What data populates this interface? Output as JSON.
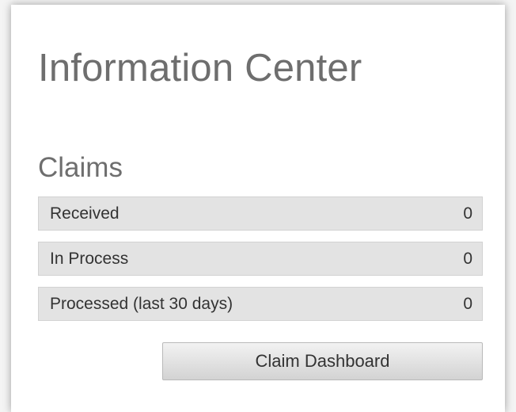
{
  "panel": {
    "title": "Information Center"
  },
  "claims": {
    "heading": "Claims",
    "rows": [
      {
        "label": "Received",
        "value": "0"
      },
      {
        "label": "In Process",
        "value": "0"
      },
      {
        "label": "Processed (last 30 days)",
        "value": "0"
      }
    ],
    "dashboard_button_label": "Claim Dashboard"
  }
}
